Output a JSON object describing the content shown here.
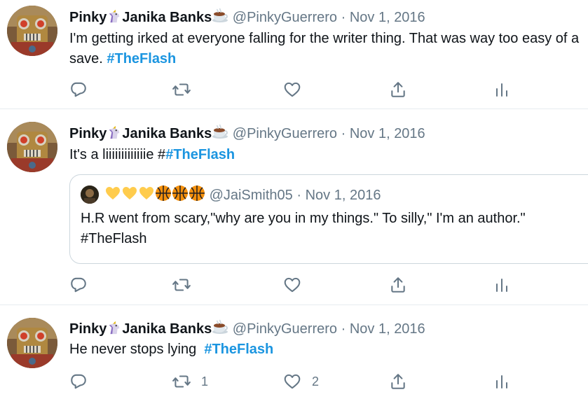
{
  "tweets": [
    {
      "user": {
        "first": "Pinky",
        "last": "Janika Banks",
        "handle": "@PinkyGuerrero",
        "sep": "·",
        "date": "Nov 1, 2016"
      },
      "text": "I'm getting irked at everyone falling for the writer thing. That was way too easy of a save. ",
      "hashtag": "#TheFlash",
      "replies": "",
      "retweets": "",
      "likes": ""
    },
    {
      "user": {
        "first": "Pinky",
        "last": "Janika Banks",
        "handle": "@PinkyGuerrero",
        "sep": "·",
        "date": "Nov 1, 2016"
      },
      "text": "It's a liiiiiiiiiiiiie #",
      "hashtag": "#TheFlash",
      "quote": {
        "handle": "@JaiSmith05",
        "sep": "·",
        "date": "Nov 1, 2016",
        "text": "H.R went from scary,\"why are you in my things.\" To silly,\" I'm an author.\" #TheFlash"
      },
      "replies": "",
      "retweets": "",
      "likes": ""
    },
    {
      "user": {
        "first": "Pinky",
        "last": "Janika Banks",
        "handle": "@PinkyGuerrero",
        "sep": "·",
        "date": "Nov 1, 2016"
      },
      "text": "He never stops lying  ",
      "hashtag": "#TheFlash",
      "replies": "",
      "retweets": "1",
      "likes": "2"
    }
  ],
  "icons": {
    "name_emoji_1": "unicorn-icon",
    "name_emoji_2": "coffee-icon",
    "reply": "reply-icon",
    "retweet": "retweet-icon",
    "like": "heart-icon",
    "share": "share-icon",
    "stats": "analytics-icon"
  },
  "colors": {
    "hashtag": "#1b95e0",
    "meta": "#657786",
    "border": "#e6ecf0"
  }
}
